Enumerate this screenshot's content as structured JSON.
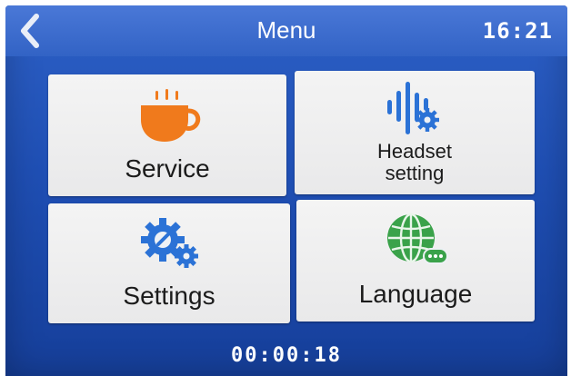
{
  "header": {
    "title": "Menu",
    "time": "16:21"
  },
  "menu": {
    "items": [
      {
        "label": "Service",
        "icon": "coffee-cup-icon"
      },
      {
        "label_line1": "Headset",
        "label_line2": "setting",
        "icon": "headset-audio-settings-icon"
      },
      {
        "label": "Settings",
        "icon": "gears-icon"
      },
      {
        "label": "Language",
        "icon": "globe-chat-icon"
      }
    ]
  },
  "footer": {
    "elapsed": "00:00:18"
  },
  "colors": {
    "screen_blue": "#2458bf",
    "tile_bg": "#f0f0f1",
    "cup_orange": "#f07a1c",
    "icon_blue": "#2b72d6",
    "globe_green": "#3aa24a"
  }
}
